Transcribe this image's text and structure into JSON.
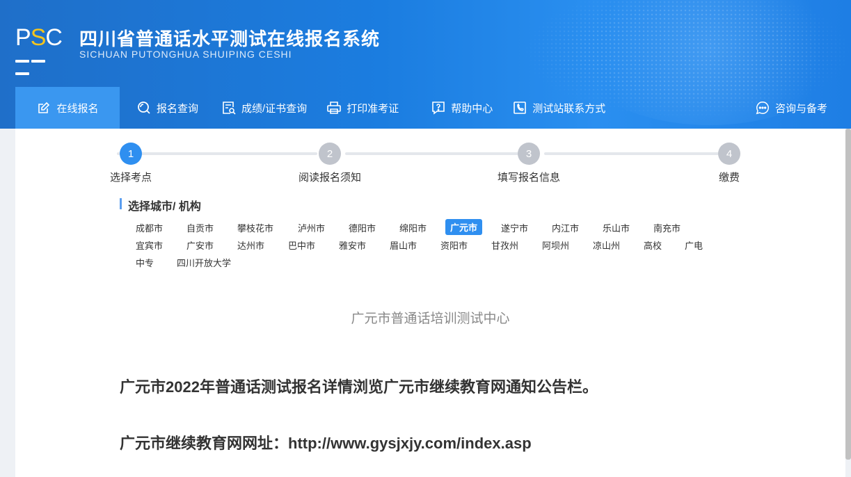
{
  "header": {
    "logo_p": "P",
    "logo_s": "S",
    "logo_c": "C",
    "title": "四川省普通话水平测试在线报名系统",
    "subtitle": "SICHUAN PUTONGHUA SHUIPING CESHI"
  },
  "nav": {
    "items": [
      {
        "label": "在线报名",
        "icon": "edit-icon",
        "active": true
      },
      {
        "label": "报名查询",
        "icon": "search-icon"
      },
      {
        "label": "成绩/证书查询",
        "icon": "certificate-search-icon"
      },
      {
        "label": "打印准考证",
        "icon": "printer-icon"
      },
      {
        "label": "帮助中心",
        "icon": "help-icon"
      },
      {
        "label": "测试站联系方式",
        "icon": "contact-icon"
      }
    ],
    "right": {
      "label": "咨询与备考",
      "icon": "chat-icon"
    }
  },
  "steps": [
    {
      "num": "1",
      "label": "选择考点",
      "active": true
    },
    {
      "num": "2",
      "label": "阅读报名须知"
    },
    {
      "num": "3",
      "label": "填写报名信息"
    },
    {
      "num": "4",
      "label": "缴费"
    }
  ],
  "section_title": "选择城市/ 机构",
  "cities": [
    "成都市",
    "自贡市",
    "攀枝花市",
    "泸州市",
    "德阳市",
    "绵阳市",
    "广元市",
    "遂宁市",
    "内江市",
    "乐山市",
    "南充市",
    "宜宾市",
    "广安市",
    "达州市",
    "巴中市",
    "雅安市",
    "眉山市",
    "资阳市",
    "甘孜州",
    "阿坝州",
    "凉山州",
    "高校",
    "广电",
    "中专",
    "四川开放大学"
  ],
  "selected_city": "广元市",
  "center_name": "广元市普通话培训测试中心",
  "notice": {
    "line1": "广元市2022年普通话测试报名详情浏览广元市继续教育网通知公告栏。",
    "line2": "广元市继续教育网网址：http://www.gysjxjy.com/index.asp"
  },
  "colors": {
    "accent": "#2f8ff0",
    "header": "#1b7de0",
    "logo_s": "#f5c51e"
  }
}
